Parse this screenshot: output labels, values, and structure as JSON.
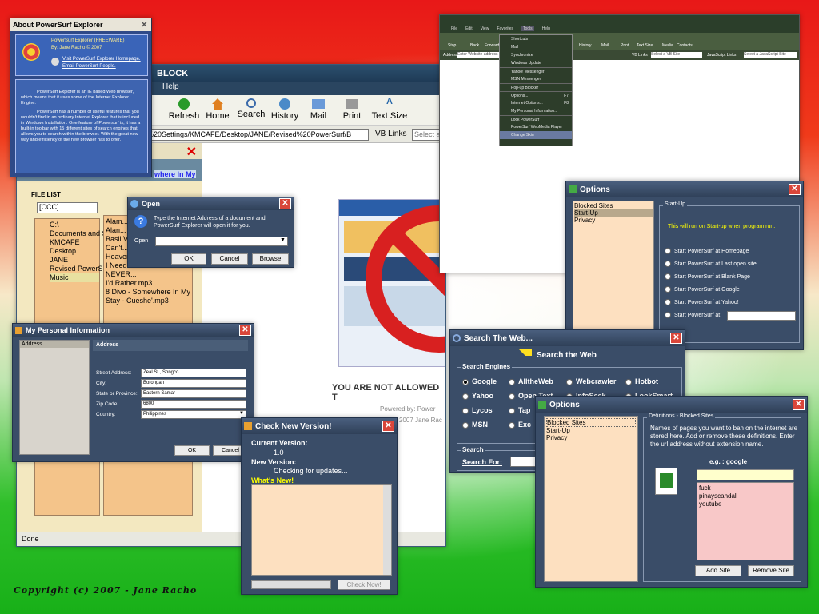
{
  "footer": {
    "copyright": "Copyright (c) 2007 - Jane Racho"
  },
  "colors": {
    "slate": "#3a4d68",
    "tan": "#fde0c0",
    "pink": "#f8c8c8",
    "red_close": "#d9463a",
    "yellow": "#ffff00"
  },
  "browser": {
    "title": "BLOCK",
    "menu_help": "Help",
    "toolbar": [
      "Refresh",
      "Home",
      "Search",
      "History",
      "Mail",
      "Print",
      "Text Size"
    ],
    "address": "%20Settings/KMCAFE/Desktop/JANE/Revised%20PowerSurf/B",
    "vb_links": "VB Links",
    "select_placeholder": "Select a",
    "status": "Done",
    "file_list": "FILE LIST",
    "drive": "[CCC]",
    "tree": [
      "C:\\",
      "Documents and S",
      "KMCAFE",
      "Desktop",
      "JANE",
      "Revised PowerS",
      "Music"
    ],
    "files": [
      "Alam...",
      "Alan...",
      "Basil V...",
      "Can't...",
      "Heaven...",
      "I Need...",
      "NEVER...",
      "I'd Rather.mp3",
      "8 Divo - Somewhere In My Pa...",
      "Stay - Cueshe'.mp3"
    ],
    "link_fragment": "where In My",
    "blocked_text": "YOU ARE NOT ALLOWED T",
    "powered_by": "Powered by: Power",
    "jane": "2007 Jane Rac"
  },
  "about": {
    "title": "About PowerSurf Explorer",
    "line1": "PowerSurf Explorer (FREEWARE)",
    "line2": "By: Jane Racho © 2007",
    "link1": "Visit PowerSurf Explorer Homepage.",
    "link2": "Email PowerSurf  People.",
    "para1": "PowerSurf Explorer is an IE based Web browser, which means that it uses some of the Internet Explorer Engine.",
    "para2": "PowerSurf has a number of useful features that you wouldn't find in an ordinary Internet Explorer that is included in Windows Installation. One feature of Powersurf is, it has a built-in toolbar with 15 different sites of search engines that allows you to search within the browser. With the great new way and efficiency of the new browser has to offer."
  },
  "open": {
    "title": "Open",
    "message": "Type the Internet Address of a document  and PowerSurf Explorer will open it for you.",
    "label": "Open",
    "ok": "OK",
    "cancel": "Cancel",
    "browse": "Browse"
  },
  "personal": {
    "title": "My Personal Information",
    "left_item": "Address",
    "header": "Address",
    "fields": [
      {
        "label": "Street Address:",
        "value": "Zeal St., Songco"
      },
      {
        "label": "City:",
        "value": "Borongan"
      },
      {
        "label": "State or Province:",
        "value": "Eastern Samar"
      },
      {
        "label": "Zip Code:",
        "value": "6800"
      },
      {
        "label": "Country:",
        "value": "Philippines"
      }
    ],
    "ok": "OK",
    "cancel": "Cancel"
  },
  "newver": {
    "title": "Check New Version!",
    "current_label": "Current Version:",
    "current_value": "1.0",
    "new_label": "New Version:",
    "checking": "Checking for updates...",
    "whats_new": "What's  New!",
    "check_now": "Check Now!"
  },
  "toolsmenu": {
    "menus": [
      "File",
      "Edit",
      "View",
      "Favorites",
      "Tools",
      "Help"
    ],
    "toolbar": [
      "Stop",
      "Back",
      "Forward",
      "History",
      "Mail",
      "Print",
      "Text Size",
      "Media",
      "Contacts"
    ],
    "address_label": "Address",
    "address_value": "Enter Website address",
    "vb_links": "VB Links",
    "select_site": "Select a VB Site",
    "js_links": "JavaScript Links",
    "select_js": "Select a JavaScript Site",
    "items": [
      "Shortcuts",
      "Mail",
      "Synchronize",
      "Windows Update",
      "Yahoo! Messenger",
      "MSN Messenger",
      "Pop-up Blocker",
      "Options...",
      "Internet Options...",
      "My Personal Information...",
      "Lock PowerSurf",
      "PowerSurf WebMedia Player",
      "Change Skin"
    ],
    "shortcuts": [
      "",
      "",
      "",
      "",
      "",
      "",
      "",
      "F7",
      "F8",
      "",
      "",
      "",
      ""
    ]
  },
  "options1": {
    "title": "Options",
    "list": [
      "Blocked Sites",
      "Start-Up",
      "Privacy"
    ],
    "selected": 1,
    "group": "Start-Up",
    "note": "This will run on Start-up when program run.",
    "radios": [
      "Start PowerSurf at Homepage",
      "Start PowerSurf at Last open site",
      "Start PowerSurf at Blank Page",
      "Start PowerSurf at Google",
      "Start PowerSurf at Yahoo!",
      "Start PowerSurf at"
    ]
  },
  "search": {
    "title": "Search  The Web...",
    "heading": "Search the Web",
    "engines_label": "Search Engines",
    "engines": [
      "Google",
      "AlltheWeb",
      "Webcrawler",
      "Hotbot",
      "Yahoo",
      "Open Text",
      "InfoSeek",
      "LookSmart",
      "Lycos",
      "Tap",
      "",
      "",
      "MSN",
      "Exc",
      "",
      ""
    ],
    "selected": 0,
    "search_label": "Search",
    "search_for": "Search For:"
  },
  "options2": {
    "title": "Options",
    "list": [
      "Blocked Sites",
      "Start-Up",
      "Privacy"
    ],
    "group": "Definitions - Blocked Sites",
    "desc": "Names of pages you want to ban on the internet are stored here. Add or remove these definitions.  Enter the url address without extension name.",
    "eg": "e.g. :   google",
    "sites": [
      "fuck",
      "pinayscandal",
      "youtube"
    ],
    "add": "Add Site",
    "remove": "Remove Site"
  }
}
